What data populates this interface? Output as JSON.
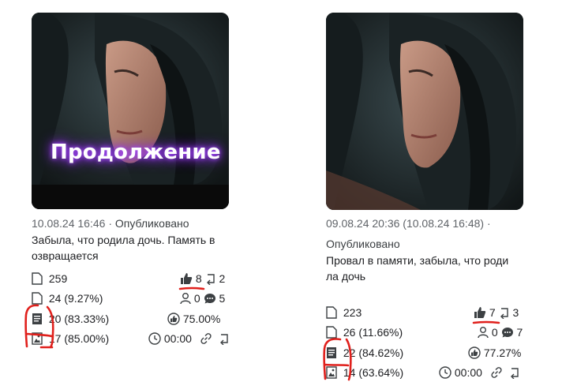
{
  "cards": [
    {
      "overlay_text": "Продолжение",
      "datetime": "10.08.24 16:46",
      "separator": "·",
      "status": "Опубликовано",
      "title_line1": "Забыла, что родила дочь. Память в",
      "title_line2": "озвращается",
      "views": "259",
      "likes": "8",
      "reposts": "2",
      "reads": "24 (9.27%)",
      "subscribers": "0",
      "comments": "5",
      "read_full": "20 (83.33%)",
      "er": "75.00%",
      "scroll_full": "17 (85.00%)",
      "time": "00:00"
    },
    {
      "datetime": "09.08.24 20:36 (10.08.24 16:48)",
      "separator": "·",
      "status": "Опубликовано",
      "title_line1": "Провал в памяти, забыла, что роди",
      "title_line2": "ла дочь",
      "views": "223",
      "likes": "7",
      "reposts": "3",
      "reads": "26 (11.66%)",
      "subscribers": "0",
      "comments": "7",
      "read_full": "22 (84.62%)",
      "er": "77.27%",
      "scroll_full": "14 (63.64%)",
      "time": "00:00"
    }
  ],
  "colors": {
    "annotation_red": "#e0201c",
    "icon_gray": "#3c4043"
  }
}
